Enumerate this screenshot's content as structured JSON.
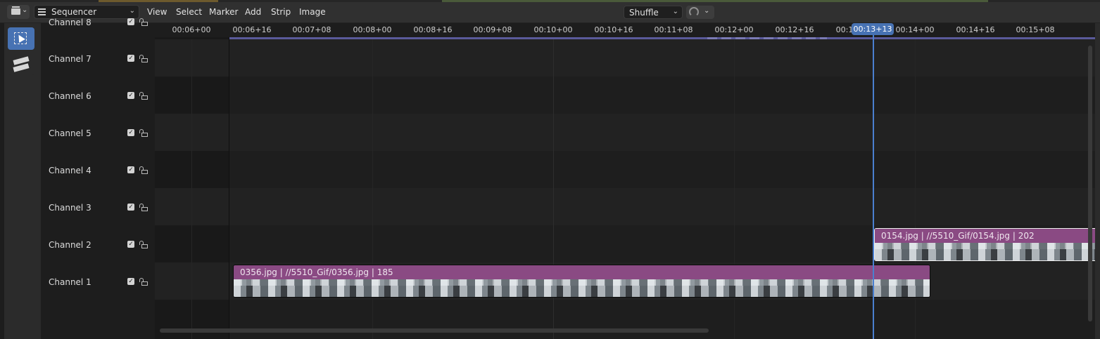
{
  "header": {
    "editor_type_icon": "clapperboard-icon",
    "mode": "Sequencer",
    "menus": [
      "View",
      "Select",
      "Marker",
      "Add",
      "Strip",
      "Image"
    ],
    "pivot": "Shuffle",
    "snap_icon": "magnet-icon"
  },
  "toolbar": {
    "tools": [
      {
        "name": "select-box-tool",
        "icon": "select-box-icon",
        "active": true
      },
      {
        "name": "blade-tool",
        "icon": "blade-icon",
        "active": false
      }
    ]
  },
  "channels": [
    {
      "name": "Channel 8",
      "visible": true
    },
    {
      "name": "Channel 7",
      "visible": true
    },
    {
      "name": "Channel 6",
      "visible": true
    },
    {
      "name": "Channel 5",
      "visible": true
    },
    {
      "name": "Channel 4",
      "visible": true
    },
    {
      "name": "Channel 3",
      "visible": true
    },
    {
      "name": "Channel 2",
      "visible": true
    },
    {
      "name": "Channel 1",
      "visible": true
    }
  ],
  "ruler": {
    "ticks": [
      "00:06+00",
      "00:06+16",
      "00:07+08",
      "00:08+00",
      "00:08+16",
      "00:09+08",
      "00:10+00",
      "00:10+16",
      "00:11+08",
      "00:12+00",
      "00:12+16",
      "00:1",
      "00:14+00",
      "00:14+16",
      "00:15+08"
    ]
  },
  "playhead": {
    "time": "00:13+13"
  },
  "strips": [
    {
      "channel": 2,
      "label": "0154.jpg | //5510_Gif/0154.jpg | 202",
      "selected": true
    },
    {
      "channel": 1,
      "label": "0356.jpg | //5510_Gif/0356.jpg | 185",
      "selected": false
    }
  ],
  "colors": {
    "strip_color": "#8a4a83",
    "playhead": "#4772b3",
    "active_tool": "#4772b3"
  }
}
